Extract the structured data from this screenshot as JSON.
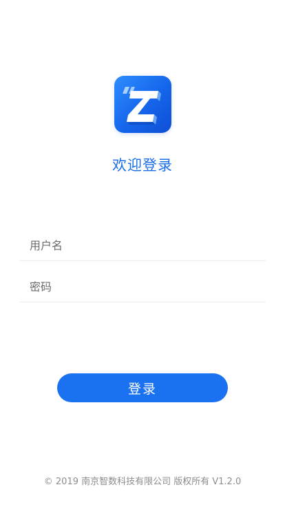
{
  "app": {
    "logo_icon": "brand-z-logo-icon",
    "welcome_title": "欢迎登录"
  },
  "form": {
    "username_placeholder": "用户名",
    "username_value": "",
    "password_placeholder": "密码",
    "password_value": ""
  },
  "actions": {
    "login_label": "登录"
  },
  "footer": {
    "copyright": "© 2019 南京智数科技有限公司 版权所有",
    "version": "V1.2.0"
  },
  "colors": {
    "accent": "#1a72f0",
    "title": "#1a6fe8",
    "logo_gradient_start": "#2f8dff",
    "logo_gradient_end": "#0f4fd6"
  }
}
